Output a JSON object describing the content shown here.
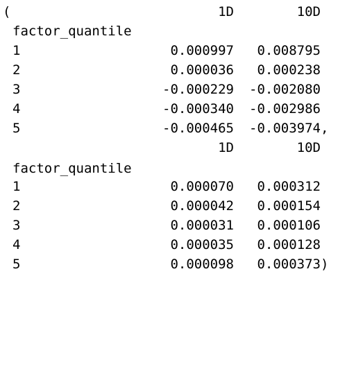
{
  "opening_paren": "(",
  "closing_paren": ")",
  "separator": ",",
  "tables": [
    {
      "columns": [
        "1D",
        "10D"
      ],
      "index_name": "factor_quantile",
      "rows": [
        {
          "index": "1",
          "values": [
            "0.000997",
            "0.008795"
          ]
        },
        {
          "index": "2",
          "values": [
            "0.000036",
            "0.000238"
          ]
        },
        {
          "index": "3",
          "values": [
            "-0.000229",
            "-0.002080"
          ]
        },
        {
          "index": "4",
          "values": [
            "-0.000340",
            "-0.002986"
          ]
        },
        {
          "index": "5",
          "values": [
            "-0.000465",
            "-0.003974"
          ]
        }
      ]
    },
    {
      "columns": [
        "1D",
        "10D"
      ],
      "index_name": "factor_quantile",
      "rows": [
        {
          "index": "1",
          "values": [
            "0.000070",
            "0.000312"
          ]
        },
        {
          "index": "2",
          "values": [
            "0.000042",
            "0.000154"
          ]
        },
        {
          "index": "3",
          "values": [
            "0.000031",
            "0.000106"
          ]
        },
        {
          "index": "4",
          "values": [
            "0.000035",
            "0.000128"
          ]
        },
        {
          "index": "5",
          "values": [
            "0.000098",
            "0.000373"
          ]
        }
      ]
    }
  ]
}
